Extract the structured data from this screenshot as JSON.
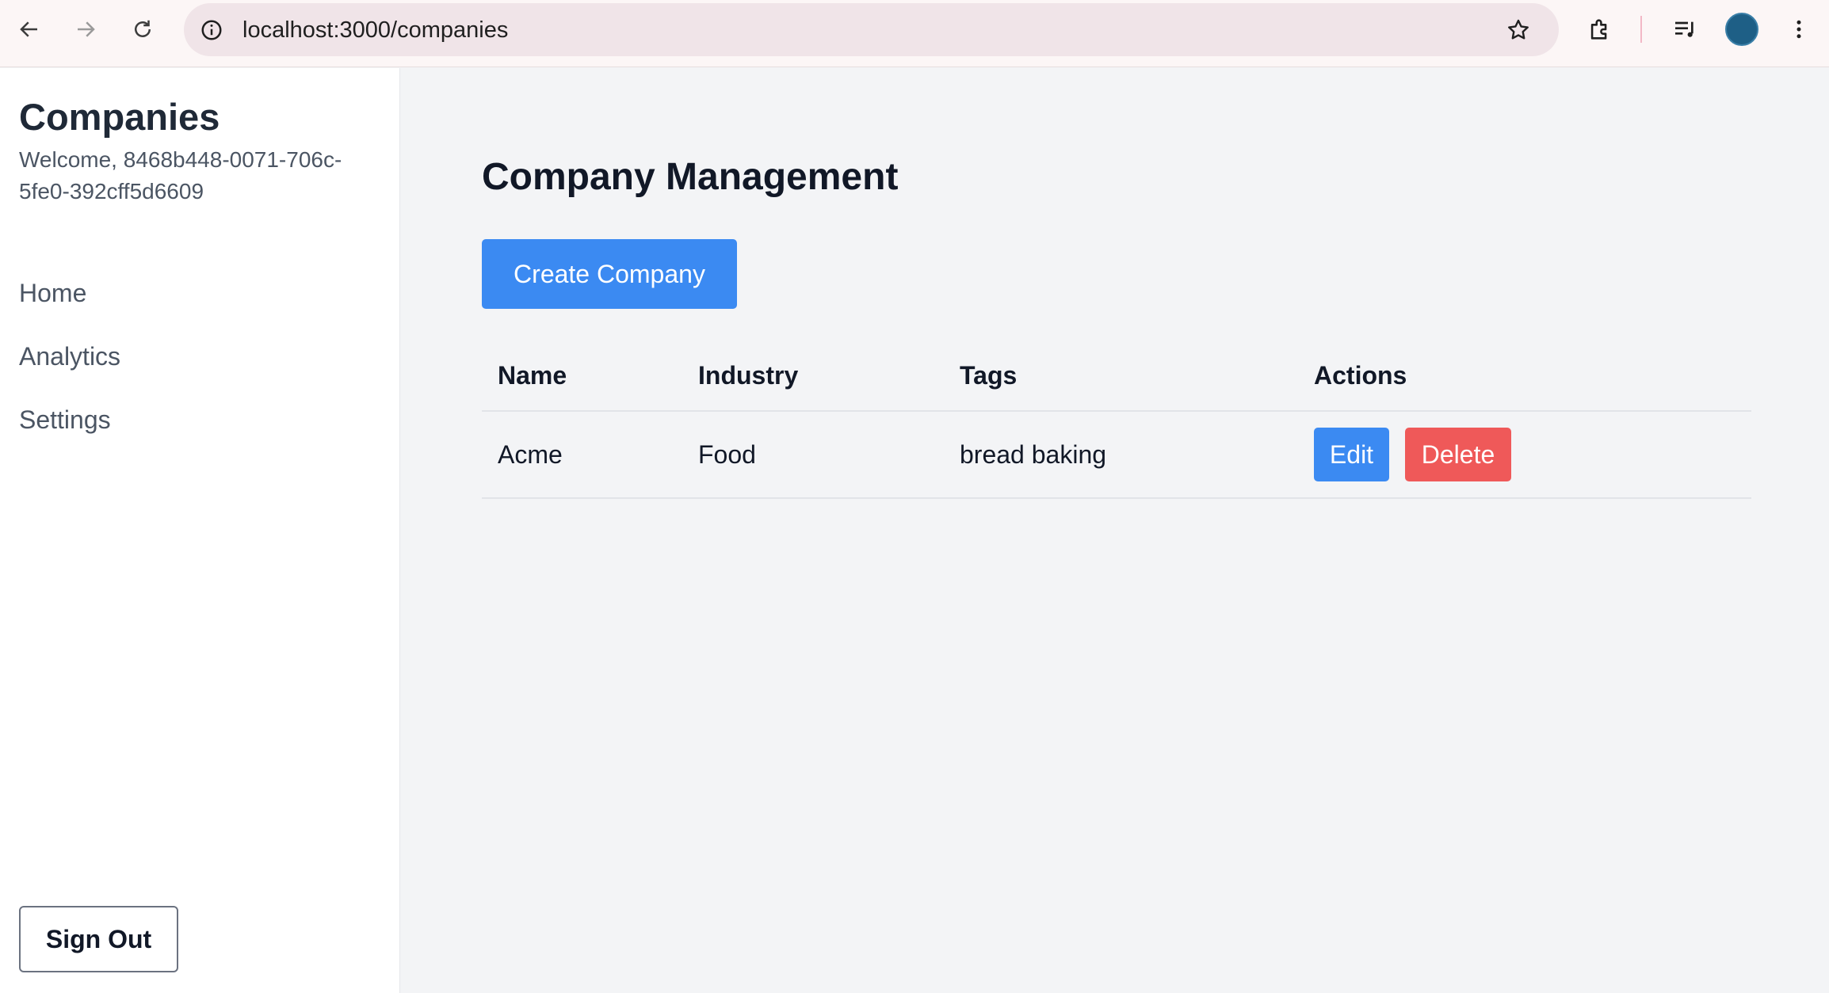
{
  "browser": {
    "url": "localhost:3000/companies",
    "icons": [
      "back-arrow-icon",
      "forward-arrow-icon",
      "reload-icon",
      "site-info-icon",
      "bookmark-star-icon",
      "extensions-puzzle-icon",
      "media-controls-icon",
      "profile-avatar",
      "more-menu-icon"
    ]
  },
  "sidebar": {
    "title": "Companies",
    "welcome": "Welcome, 8468b448-0071-706c-5fe0-392cff5d6609",
    "nav": [
      {
        "label": "Home"
      },
      {
        "label": "Analytics"
      },
      {
        "label": "Settings"
      }
    ],
    "sign_out_label": "Sign Out"
  },
  "main": {
    "title": "Company Management",
    "create_label": "Create Company",
    "table": {
      "headers": [
        "Name",
        "Industry",
        "Tags",
        "Actions"
      ],
      "rows": [
        {
          "name": "Acme",
          "industry": "Food",
          "tags": "bread baking",
          "edit_label": "Edit",
          "delete_label": "Delete"
        }
      ]
    }
  },
  "colors": {
    "primary": "#3b8af2",
    "danger": "#ef5959",
    "background": "#f3f4f6",
    "sidebar": "#ffffff"
  }
}
